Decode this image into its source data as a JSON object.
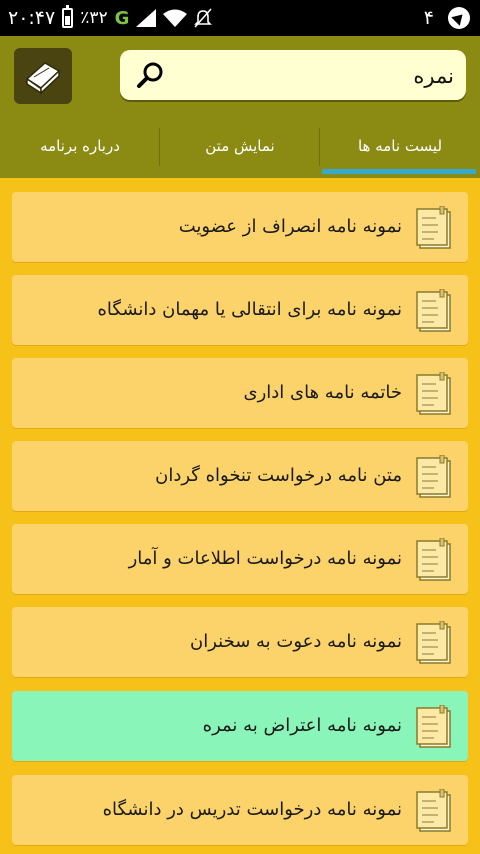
{
  "status_bar": {
    "time": "۲۰:۴۷",
    "battery_pct": "٪۳۲",
    "network": "G",
    "notification_count": "۴"
  },
  "header": {
    "search_value": "نمره",
    "search_placeholder": ""
  },
  "tabs": [
    {
      "label": "لیست نامه ها",
      "active": true
    },
    {
      "label": "نمایش متن",
      "active": false
    },
    {
      "label": "درباره برنامه",
      "active": false
    }
  ],
  "letters": [
    {
      "label": "نمونه نامه انصراف از عضویت"
    },
    {
      "label": "نمونه نامه برای انتقالی یا مهمان دانشگاه"
    },
    {
      "label": "خاتمه نامه های اداری"
    },
    {
      "label": "متن نامه درخواست تنخواه گردان"
    },
    {
      "label": "نمونه نامه درخواست اطلاعات و آمار"
    },
    {
      "label": "نمونه نامه دعوت به سخنران"
    },
    {
      "label": "نمونه نامه اعتراض به نمره",
      "highlighted": true
    },
    {
      "label": "نمونه نامه درخواست تدریس در دانشگاه"
    }
  ],
  "colors": {
    "background": "#f6c21a",
    "header": "#8b8b14",
    "item": "#fbd36a",
    "item_highlight": "#8af5b8",
    "tab_indicator": "#36a9cc"
  }
}
